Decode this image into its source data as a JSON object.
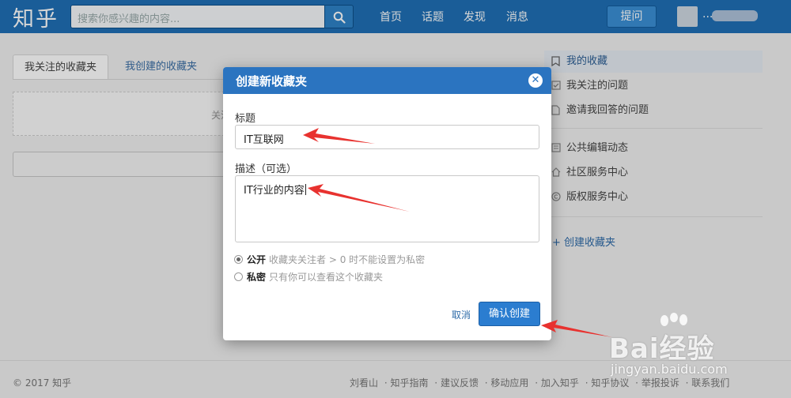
{
  "header": {
    "logo": "知乎",
    "search_placeholder": "搜索你感兴趣的内容...",
    "nav": [
      "首页",
      "话题",
      "发现",
      "消息"
    ],
    "ask_label": "提问",
    "user_name": "..."
  },
  "main": {
    "tabs": [
      "我关注的收藏夹",
      "我创建的收藏夹"
    ],
    "empty_text": "关注的"
  },
  "sidebar": {
    "items": [
      "我的收藏",
      "我关注的问题",
      "邀请我回答的问题",
      "公共编辑动态",
      "社区服务中心",
      "版权服务中心"
    ],
    "create_label": "+ 创建收藏夹"
  },
  "dialog": {
    "title": "创建新收藏夹",
    "close_icon": "close-icon",
    "title_label": "标题",
    "title_value": "IT互联网",
    "desc_label": "描述（可选）",
    "desc_value": "IT行业的内容",
    "public_label": "公开",
    "public_desc": "收藏夹关注者 > 0 时不能设置为私密",
    "private_label": "私密",
    "private_desc": "只有你可以查看这个收藏夹",
    "public_selected": true,
    "cancel_label": "取消",
    "confirm_label": "确认创建"
  },
  "footer": {
    "copyright": "© 2017 知乎",
    "links": [
      "刘看山",
      "知乎指南",
      "建议反馈",
      "移动应用",
      "加入知乎",
      "知乎协议",
      "举报投诉",
      "联系我们"
    ]
  },
  "watermark": {
    "brand": "Bai经验",
    "url": "jingyan.baidu.com"
  },
  "colors": {
    "header_bg": "#1f6fb5",
    "dialog_header": "#2b74c0",
    "primary_button": "#2b7dd0",
    "annotation_arrow": "#e8322f"
  }
}
